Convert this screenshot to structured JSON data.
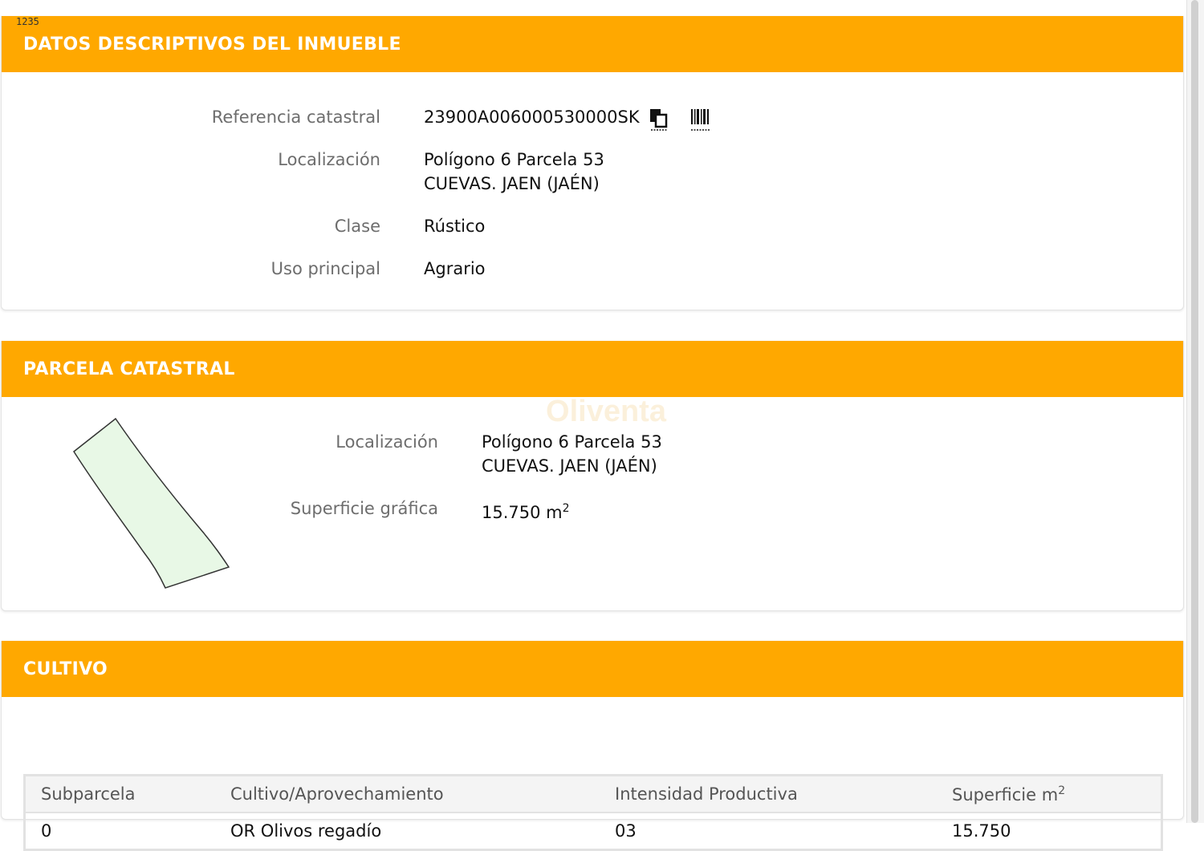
{
  "page_tag": "1235",
  "datos": {
    "title": "DATOS DESCRIPTIVOS DEL INMUEBLE",
    "ref_label": "Referencia catastral",
    "ref_value": "23900A006000530000SK",
    "loc_label": "Localización",
    "loc_line1": "Polígono 6 Parcela 53",
    "loc_line2": "CUEVAS. JAEN (JAÉN)",
    "clase_label": "Clase",
    "clase_value": "Rústico",
    "uso_label": "Uso principal",
    "uso_value": "Agrario"
  },
  "parcela": {
    "title": "PARCELA CATASTRAL",
    "loc_label": "Localización",
    "loc_line1": "Polígono 6 Parcela 53",
    "loc_line2": "CUEVAS. JAEN (JAÉN)",
    "sup_label": "Superficie gráfica",
    "sup_value": "15.750 m",
    "sup_unit_exp": "2",
    "shape_fill": "#e8f8e6"
  },
  "watermark": "Oliventa",
  "cultivo": {
    "title": "CULTIVO",
    "headers": [
      "Subparcela",
      "Cultivo/Aprovechamiento",
      "Intensidad Productiva",
      "Superficie m"
    ],
    "header_exp": "2",
    "rows": [
      [
        "0",
        "OR Olivos regadío",
        "03",
        "15.750"
      ]
    ]
  },
  "colors": {
    "header_bg": "#ffa800",
    "header_text": "#ffffff"
  },
  "icons": [
    "copy-icon",
    "barcode-icon"
  ]
}
